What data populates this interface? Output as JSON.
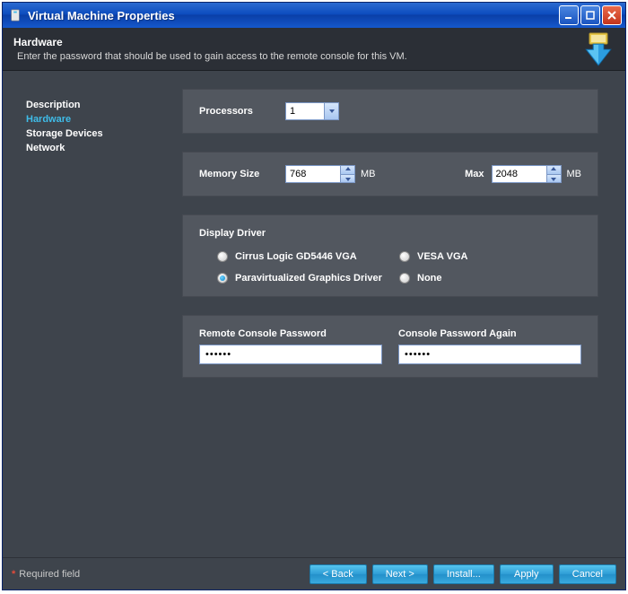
{
  "window": {
    "title": "Virtual Machine Properties"
  },
  "header": {
    "title": "Hardware",
    "subtitle": "Enter the password that should be used to gain access to the remote console for this VM."
  },
  "sidebar": {
    "items": [
      {
        "label": "Description",
        "active": false
      },
      {
        "label": "Hardware",
        "active": true
      },
      {
        "label": "Storage Devices",
        "active": false
      },
      {
        "label": "Network",
        "active": false
      }
    ]
  },
  "hardware": {
    "processors": {
      "label": "Processors",
      "value": "1"
    },
    "memory": {
      "label": "Memory Size",
      "value": "768",
      "unit": "MB",
      "max_label": "Max",
      "max_value": "2048",
      "max_unit": "MB"
    },
    "display_driver": {
      "label": "Display Driver",
      "options": [
        {
          "label": "Cirrus Logic GD5446 VGA",
          "checked": false
        },
        {
          "label": "VESA VGA",
          "checked": false
        },
        {
          "label": "Paravirtualized Graphics Driver",
          "checked": true
        },
        {
          "label": "None",
          "checked": false
        }
      ]
    },
    "password": {
      "label1": "Remote Console Password",
      "value1": "••••••",
      "label2": "Console Password Again",
      "value2": "••••••"
    }
  },
  "footer": {
    "required_note": "Required field",
    "buttons": {
      "back": "< Back",
      "next": "Next >",
      "install": "Install...",
      "apply": "Apply",
      "cancel": "Cancel"
    }
  }
}
